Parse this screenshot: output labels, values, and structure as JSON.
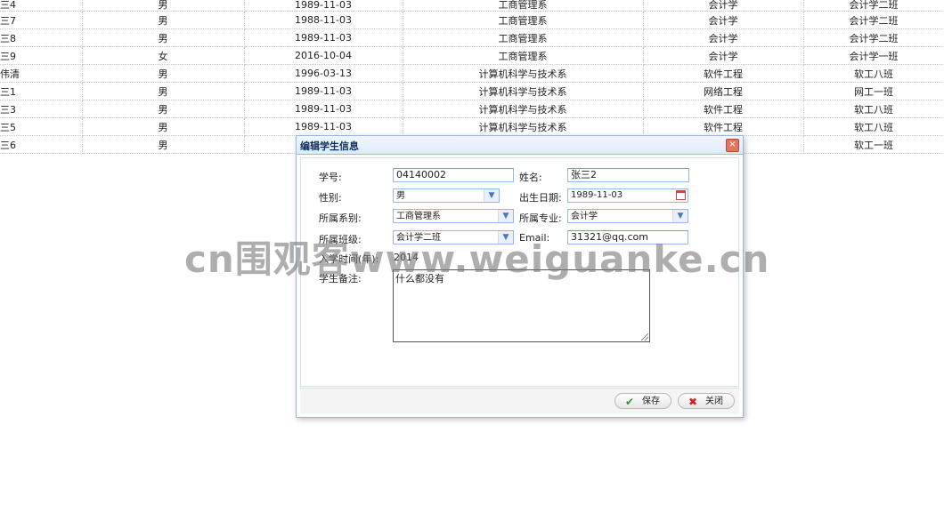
{
  "background_table": {
    "rows": [
      {
        "name": "三4",
        "gender": "男",
        "birth": "1989-11-03",
        "dept": "工商管理系",
        "major": "会计学",
        "class": "会计学二班"
      },
      {
        "name": "三7",
        "gender": "男",
        "birth": "1988-11-03",
        "dept": "工商管理系",
        "major": "会计学",
        "class": "会计学二班"
      },
      {
        "name": "三8",
        "gender": "男",
        "birth": "1989-11-03",
        "dept": "工商管理系",
        "major": "会计学",
        "class": "会计学二班"
      },
      {
        "name": "三9",
        "gender": "女",
        "birth": "2016-10-04",
        "dept": "工商管理系",
        "major": "会计学",
        "class": "会计学一班"
      },
      {
        "name": "伟清",
        "gender": "男",
        "birth": "1996-03-13",
        "dept": "计算机科学与技术系",
        "major": "软件工程",
        "class": "软工八班"
      },
      {
        "name": "三1",
        "gender": "男",
        "birth": "1989-11-03",
        "dept": "计算机科学与技术系",
        "major": "网络工程",
        "class": "网工一班"
      },
      {
        "name": "三3",
        "gender": "男",
        "birth": "1989-11-03",
        "dept": "计算机科学与技术系",
        "major": "软件工程",
        "class": "软工八班"
      },
      {
        "name": "三5",
        "gender": "男",
        "birth": "1989-11-03",
        "dept": "计算机科学与技术系",
        "major": "软件工程",
        "class": "软工八班"
      },
      {
        "name": "三6",
        "gender": "男",
        "birth": "",
        "dept": "",
        "major": "",
        "class": "软工一班"
      }
    ]
  },
  "dialog": {
    "title": "编辑学生信息",
    "close_glyph": "×",
    "fields": {
      "student_id": {
        "label": "学号:",
        "value": "04140002"
      },
      "name": {
        "label": "姓名:",
        "value": "张三2"
      },
      "gender": {
        "label": "性别:",
        "value": "男"
      },
      "birth_date": {
        "label": "出生日期:",
        "value": "1989-11-03"
      },
      "department": {
        "label": "所属系别:",
        "value": "工商管理系"
      },
      "major": {
        "label": "所属专业:",
        "value": "会计学"
      },
      "class": {
        "label": "所属班级:",
        "value": "会计学二班"
      },
      "email": {
        "label": "Email:",
        "value": "31321@qq.com"
      },
      "enroll_year": {
        "label": "入学时间(年):",
        "value": "2014"
      },
      "remarks": {
        "label": "学生备注:",
        "value": "什么都没有"
      }
    },
    "buttons": {
      "save": {
        "label": "保存",
        "icon": "✔"
      },
      "close": {
        "label": "关闭",
        "icon": "✖"
      }
    }
  },
  "watermark": "cn围观客www.weiguanke.cn"
}
